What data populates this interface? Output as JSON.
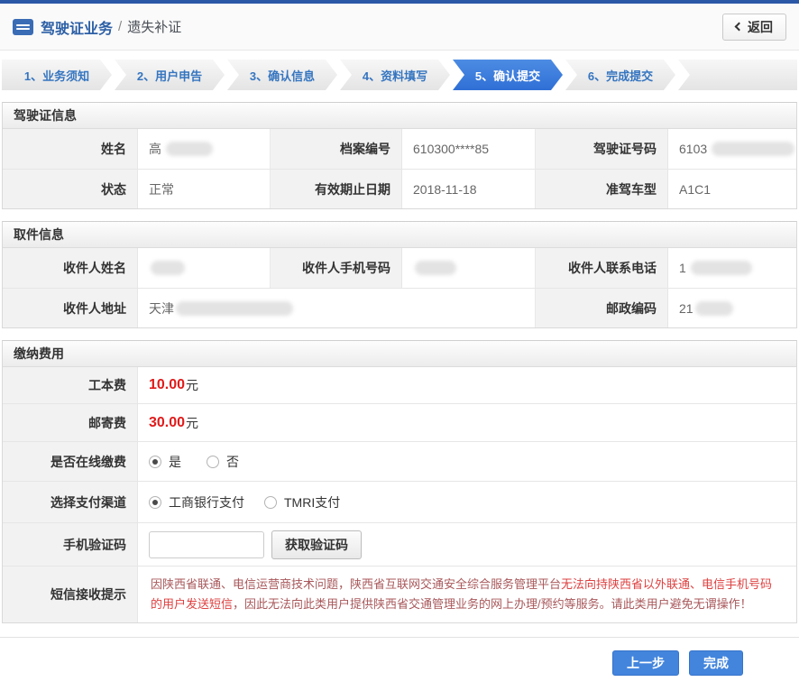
{
  "header": {
    "title": "驾驶证业务",
    "separator": "/",
    "subtitle": "遗失补证",
    "back_label": "返回"
  },
  "steps": {
    "items": [
      {
        "label": "1、业务须知",
        "active": false
      },
      {
        "label": "2、用户申告",
        "active": false
      },
      {
        "label": "3、确认信息",
        "active": false
      },
      {
        "label": "4、资料填写",
        "active": false
      },
      {
        "label": "5、确认提交",
        "active": true
      },
      {
        "label": "6、完成提交",
        "active": false
      }
    ]
  },
  "license": {
    "title": "驾驶证信息",
    "rows": [
      [
        {
          "label": "姓名",
          "value": "高",
          "redacted": true
        },
        {
          "label": "档案编号",
          "value": "610300****85",
          "redacted": false
        },
        {
          "label": "驾驶证号码",
          "value": "6103",
          "redacted": true
        }
      ],
      [
        {
          "label": "状态",
          "value": "正常",
          "redacted": false
        },
        {
          "label": "有效期止日期",
          "value": "2018-11-18",
          "redacted": false
        },
        {
          "label": "准驾车型",
          "value": "A1C1",
          "redacted": false
        }
      ]
    ]
  },
  "pickup": {
    "title": "取件信息",
    "row1": [
      {
        "label": "收件人姓名",
        "value": "",
        "redacted": true
      },
      {
        "label": "收件人手机号码",
        "value": "",
        "redacted": true
      },
      {
        "label": "收件人联系电话",
        "value": "1",
        "redacted": true
      }
    ],
    "row2": [
      {
        "label": "收件人地址",
        "value": "天津",
        "redacted": true
      },
      {
        "label": "邮政编码",
        "value": "21",
        "redacted": true
      }
    ]
  },
  "payment": {
    "title": "缴纳费用",
    "fees": [
      {
        "label": "工本费",
        "amount": "10.00",
        "unit": "元"
      },
      {
        "label": "邮寄费",
        "amount": "30.00",
        "unit": "元"
      }
    ],
    "online": {
      "label": "是否在线缴费",
      "options": [
        {
          "label": "是",
          "selected": true
        },
        {
          "label": "否",
          "selected": false
        }
      ]
    },
    "channel": {
      "label": "选择支付渠道",
      "options": [
        {
          "label": "工商银行支付",
          "selected": true
        },
        {
          "label": "TMRI支付",
          "selected": false
        }
      ]
    },
    "sms": {
      "label": "手机验证码",
      "input_value": "",
      "button_label": "获取验证码"
    },
    "notice": {
      "label": "短信接收提示",
      "part1": "因陕西省联通、电信运营商技术问题，陕西省互联网交通安全综合服务管理平台",
      "part2": "无法向持陕西省以外联通、电信手机号码的用户发送短信",
      "part3": "，因此无法向此类用户提供陕西省交通管理业务的网上办理/预约等服务。请此类用户避免无谓操作！"
    }
  },
  "footer": {
    "prev_label": "上一步",
    "done_label": "完成"
  },
  "colors": {
    "accent_blue": "#2b57a7",
    "step_active_blue": "#3b7dde",
    "fee_red": "#e01a1a",
    "notice_red": "#dd4040"
  }
}
